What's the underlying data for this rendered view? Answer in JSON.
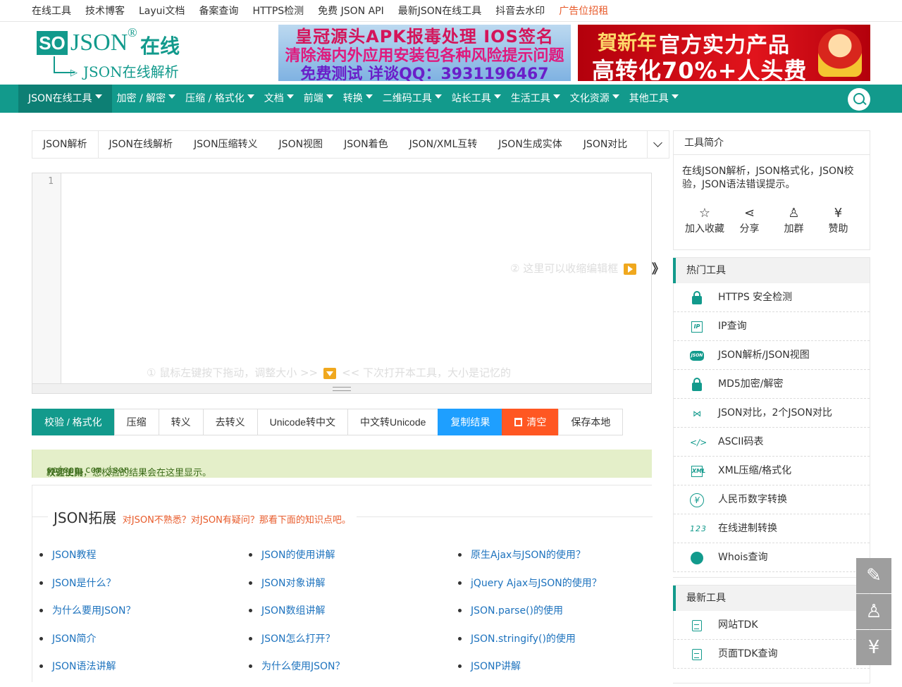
{
  "topbar": {
    "links": [
      "在线工具",
      "技术博客",
      "Layui文档",
      "备案查询",
      "HTTPS检测",
      "免费 JSON API",
      "最新JSON在线工具",
      "抖音去水印"
    ],
    "ad_link": "广告位招租"
  },
  "logo": {
    "so": "SO",
    "json": "JSON",
    "reg": "®",
    "online": "在线",
    "subtitle": "JSON在线解析"
  },
  "banners": {
    "left": {
      "line1": "皇冠源头APK报毒处理 IOS签名",
      "line2": "清除海内外应用安装包各种风险提示问题",
      "line3": "免费测试 详谈QQ：3931196467"
    },
    "right": {
      "newyear": "賀新年",
      "title": "官方实力产品",
      "slogan": "高转化70%+人头费"
    }
  },
  "nav": {
    "items": [
      "JSON在线工具",
      "加密 / 解密",
      "压缩 / 格式化",
      "文档",
      "前端",
      "转换",
      "二维码工具",
      "站长工具",
      "生活工具",
      "文化资源",
      "其他工具"
    ],
    "search_icon": "search-icon"
  },
  "tabs": [
    "JSON解析",
    "JSON在线解析",
    "JSON压缩转义",
    "JSON视图",
    "JSON着色",
    "JSON/XML互转",
    "JSON生成实体",
    "JSON对比"
  ],
  "editor": {
    "line_number": "1",
    "hint_collapse": "② 这里可以收缩编辑框",
    "hint_resize_a": "① 鼠标左键按下拖动，调整大小 >>",
    "hint_resize_b": "<< 下次打开本工具，大小是记忆的",
    "collapse_glyph": "》"
  },
  "actions": {
    "validate": "校验 / 格式化",
    "compress": "压缩",
    "escape": "转义",
    "unescape": "去转义",
    "unicode_to_cn": "Unicode转中文",
    "cn_to_unicode": "中文转Unicode",
    "copy": "复制结果",
    "clear": "清空",
    "save": "保存本地"
  },
  "result": {
    "prefix": "欢迎使用 ",
    "site": "sojson.com json",
    "suffix": "校验工具，您校验的结果会在这里显示。"
  },
  "knowledge": {
    "title": "JSON拓展",
    "subtitle": "对JSON不熟悉？对JSON有疑问？那看下面的知识点吧。",
    "col1": [
      "JSON教程",
      "JSON是什么？",
      "为什么要用JSON？",
      "JSON简介",
      "JSON语法讲解"
    ],
    "col2": [
      "JSON的使用讲解",
      "JSON对象讲解",
      "JSON数组讲解",
      "JSON怎么打开？",
      "为什么使用JSON？"
    ],
    "col3": [
      "原生Ajax与JSON的使用？",
      "jQuery Ajax与JSON的使用？",
      "JSON.parse()的使用",
      "JSON.stringify()的使用",
      "JSONP讲解"
    ]
  },
  "sidebar": {
    "intro": {
      "title": "工具简介",
      "desc": "在线JSON解析，JSON格式化，JSON校验，JSON语法错误提示。",
      "actions": [
        {
          "label": "加入收藏",
          "icon": "star-icon",
          "glyph": "☆"
        },
        {
          "label": "分享",
          "icon": "share-icon",
          "glyph": "⋖"
        },
        {
          "label": "加群",
          "icon": "qq-icon",
          "glyph": "♙"
        },
        {
          "label": "赞助",
          "icon": "yen-icon",
          "glyph": "¥"
        }
      ]
    },
    "hot": {
      "title": "热门工具",
      "items": [
        {
          "label": "HTTPS 安全检测",
          "icon": "lock-icon"
        },
        {
          "label": "IP查询",
          "icon": "ip-icon"
        },
        {
          "label": "JSON解析/JSON视图",
          "icon": "json-icon"
        },
        {
          "label": "MD5加密/解密",
          "icon": "lock-icon"
        },
        {
          "label": "JSON对比，2个JSON对比",
          "icon": "compare-icon"
        },
        {
          "label": "ASCII码表",
          "icon": "code-icon"
        },
        {
          "label": "XML压缩/格式化",
          "icon": "xml-icon"
        },
        {
          "label": "人民币数字转换",
          "icon": "yen-circle-icon"
        },
        {
          "label": "在线进制转换",
          "icon": "number-icon"
        },
        {
          "label": "Whois查询",
          "icon": "globe-icon"
        }
      ],
      "glyphs": {
        "ip": "IP",
        "json": "JSON",
        "compare": "⋈",
        "code": "</>",
        "xml": "XML",
        "yen": "¥",
        "num": "123"
      }
    },
    "newest": {
      "title": "最新工具",
      "items": [
        {
          "label": "网站TDK",
          "icon": "document-icon"
        },
        {
          "label": "页面TDK查询",
          "icon": "document-icon"
        }
      ]
    }
  },
  "floats": {
    "feedback": "✎",
    "qq": "♙",
    "donate": "¥"
  },
  "colors": {
    "brand": "#129a8c",
    "brand_dark": "#0d7f74",
    "blue": "#1e9fff",
    "orange": "#ff5722",
    "result_bg": "#e4efc9",
    "link": "#1e73be",
    "ad": "#e85b2b"
  }
}
